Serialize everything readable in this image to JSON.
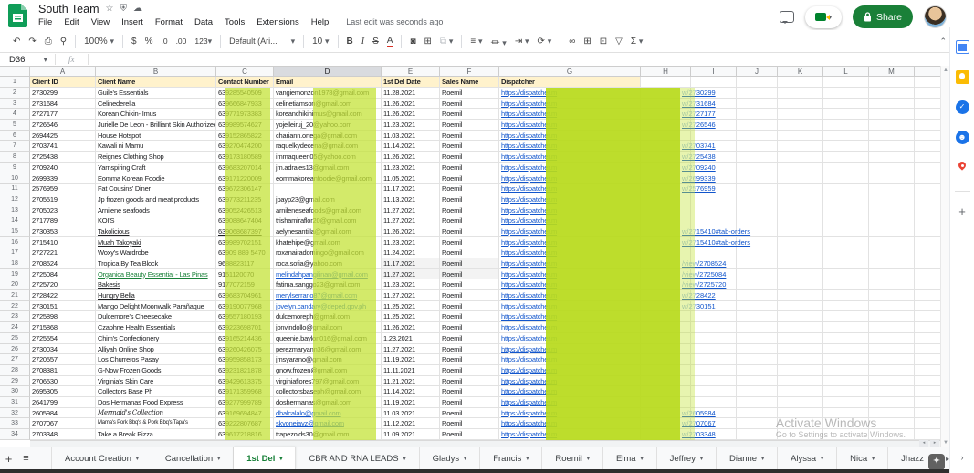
{
  "titlebar": {
    "title": "South Team",
    "menu": [
      "File",
      "Edit",
      "View",
      "Insert",
      "Format",
      "Data",
      "Tools",
      "Extensions",
      "Help"
    ],
    "last_edit": "Last edit was seconds ago",
    "share_label": "Share"
  },
  "toolbar": {
    "zoom": "100%",
    "currency": "$",
    "percent": "%",
    "dec_less": ".0",
    "dec_more": ".00",
    "more_formats": "123",
    "font": "Default (Ari...",
    "font_size": "10",
    "bold": "B",
    "italic": "I",
    "strike": "S",
    "text_color": "A",
    "functions": "Σ"
  },
  "formula_bar": {
    "cell_ref": "D36",
    "fx": "fx"
  },
  "grid": {
    "col_letters": [
      "A",
      "B",
      "C",
      "D",
      "E",
      "F",
      "G",
      "H",
      "I",
      "J",
      "K",
      "L",
      "M",
      ""
    ],
    "selected_col": "D",
    "header_row": [
      "Client ID",
      "Client Name",
      "Contact Number",
      "Email",
      "1st Del Date",
      "Sales Name",
      "Dispatcher"
    ],
    "disp_prefix": "https://dispatcher.m",
    "rows": [
      {
        "n": 2,
        "id": "2730299",
        "name": "Guile's Essentials",
        "phone": "639285540509",
        "email": "vangiemonzon1978@gmail.com",
        "date": "11.28.2021",
        "sales": "Roemil",
        "h_tint": "w/27",
        "h_dark": "30299"
      },
      {
        "n": 3,
        "id": "2731684",
        "name": "Celinederella",
        "phone": "639666847933",
        "email": "celinetiamson@gmail.com",
        "date": "11.26.2021",
        "sales": "Roemil",
        "h_tint": "w/27",
        "h_dark": "31684"
      },
      {
        "n": 4,
        "id": "2727177",
        "name": "Korean Chikin- Imus",
        "phone": "639771973383",
        "email": "koreanchikinimus@gmail.com",
        "date": "11.26.2021",
        "sales": "Roemil",
        "h_tint": "w/27",
        "h_dark": "27177"
      },
      {
        "n": 5,
        "id": "2726546",
        "name": "Jurielle De Leon - Brilliant Skin Authorized Seller",
        "phone": "639989574627",
        "email": "yojelleiruj_20@yahoo.com",
        "date": "11.23.2021",
        "sales": "Roemil",
        "h_tint": "w/27",
        "h_dark": "26546"
      },
      {
        "n": 6,
        "id": "2694425",
        "name": "House Hotspot",
        "phone": "639152865822",
        "email": "chariann.ortega@gmail.com",
        "date": "11.03.2021",
        "sales": "Roemil",
        "h_tint": "",
        "h_dark": ""
      },
      {
        "n": 7,
        "id": "2703741",
        "name": "Kawali ni Mamu",
        "phone": "639270474200",
        "email": "raquelkydecena@gmail.com",
        "date": "11.14.2021",
        "sales": "Roemil",
        "h_tint": "w/27",
        "h_dark": "03741"
      },
      {
        "n": 8,
        "id": "2725438",
        "name": "Reignes Clothing Shop",
        "phone": "639173180589",
        "email": "immaqueen05@yahoo.com",
        "date": "11.26.2021",
        "sales": "Roemil",
        "h_tint": "w/27",
        "h_dark": "25438"
      },
      {
        "n": 9,
        "id": "2709240",
        "name": "Yarnspiring Craft",
        "phone": "639683207014",
        "email": "jm.adrales13@gmail.com",
        "date": "11.23.2021",
        "sales": "Roemil",
        "h_tint": "w/27",
        "h_dark": "09240"
      },
      {
        "n": 10,
        "id": "2699339",
        "name": "Eomma Korean Foodie",
        "phone": "639171220009",
        "email": "eommakoreanfoodie@gmail.com",
        "date": "11.05.2021",
        "sales": "Roemil",
        "h_tint": "w/26",
        "h_dark": "99339"
      },
      {
        "n": 11,
        "id": "2576959",
        "name": "Fat Cousins' Diner",
        "phone": "639672306147",
        "email": "",
        "date": "11.17.2021",
        "sales": "Roemil",
        "h_tint": "w/25",
        "h_dark": "76959"
      },
      {
        "n": 12,
        "id": "2705519",
        "name": "Jp frozen goods and meat products",
        "phone": "639773211235",
        "email": "jpayp23@gmail.com",
        "date": "11.13.2021",
        "sales": "Roemil",
        "h_tint": "",
        "h_dark": ""
      },
      {
        "n": 13,
        "id": "2705023",
        "name": "Arnilene seafoods",
        "phone": "639052426513",
        "email": "arnileneseafoods@gmail.com",
        "date": "11.27.2021",
        "sales": "Roemil",
        "h_tint": "",
        "h_dark": ""
      },
      {
        "n": 14,
        "id": "2717789",
        "name": "KOI'S",
        "phone": "639088647404",
        "email": "trishamiraflor20@gmail.com",
        "date": "11.27.2021",
        "sales": "Roemil",
        "h_tint": "",
        "h_dark": ""
      },
      {
        "n": 15,
        "id": "2730353",
        "name": "Takolicious",
        "name_style": "dlink",
        "phone": "639068687397",
        "phone_style": "dlink",
        "email": "aelynesantilla@gmail.com",
        "date": "11.26.2021",
        "sales": "Roemil",
        "h_tint": "w/27",
        "h_dark": "15410#tab-orders"
      },
      {
        "n": 16,
        "id": "2715410",
        "name": "Muah Takoyaki",
        "name_style": "dlink",
        "phone": "639989702151",
        "email": "khatehipe@gmail.com",
        "date": "11.23.2021",
        "sales": "Roemil",
        "h_tint": "w/27",
        "h_dark": "15410#tab-orders"
      },
      {
        "n": 17,
        "id": "2727221",
        "name": "Woxy's Wardrobe",
        "phone": "63909 889 5470",
        "email": "roxanairadomingo@gmail.com",
        "date": "11.24.2021",
        "sales": "Roemil",
        "h_tint": "",
        "h_dark": ""
      },
      {
        "n": 18,
        "id": "2708524",
        "name": "Tropica By Tea Block",
        "phone": "9688823117",
        "email": "roca.sofia@yahoo.com",
        "date": "11.17.2021",
        "sales": "Roemil",
        "h_tint": "/view",
        "h_dark": "/2708524",
        "shade": true
      },
      {
        "n": 19,
        "id": "2725084",
        "name": "Organica Beauty Essential - Las Pinas",
        "name_style": "glink",
        "phone": "9151120070",
        "email": "melindahpangilinan@gmail.com",
        "email_style": "link",
        "date": "11.27.2021",
        "sales": "Roemil",
        "h_tint": "/view",
        "h_dark": "/2725084",
        "shade": true
      },
      {
        "n": 20,
        "id": "2725720",
        "name": "Bakesis",
        "name_style": "dlink",
        "phone": "9177072159",
        "email": "fatima.sanggo23@gmail.com",
        "date": "11.23.2021",
        "sales": "Roemil",
        "h_tint": "/view",
        "h_dark": "/2725720"
      },
      {
        "n": 21,
        "id": "2728422",
        "name": "Hungry Bella",
        "name_style": "dlink",
        "phone": "639683704961",
        "email": "merylserrano87@gmail.com",
        "email_style": "link",
        "date": "11.27.2021",
        "sales": "Roemil",
        "h_tint": "w/27",
        "h_dark": "28422"
      },
      {
        "n": 22,
        "id": "2730151",
        "name": "Mango Delight Moonwalk Parañaque",
        "name_style": "dlink",
        "phone": "639190077968",
        "email": "jovelyn.candary@deped.gov.ph",
        "email_style": "link",
        "date": "11.25.2021",
        "sales": "Roemil",
        "h_tint": "w/27",
        "h_dark": "30151"
      },
      {
        "n": 23,
        "id": "2725898",
        "name": "Dulcemore's Cheesecake",
        "phone": "639557180193",
        "email": "dulcemoreph@gmail.com",
        "date": "11.25.2021",
        "sales": "Roemil",
        "h_tint": "",
        "h_dark": ""
      },
      {
        "n": 24,
        "id": "2715868",
        "name": "Czaphne Health Essentials",
        "phone": "639223698701",
        "email": "jonvindollo@gmail.com",
        "date": "11.26.2021",
        "sales": "Roemil",
        "h_tint": "",
        "h_dark": ""
      },
      {
        "n": 25,
        "id": "2725554",
        "name": "Chim's Confectionery",
        "phone": "639165214436",
        "email": "queenie.baylon016@gmail.com",
        "date": "1.23.2021",
        "sales": "Roemil",
        "h_tint": "",
        "h_dark": ""
      },
      {
        "n": 26,
        "id": "2730034",
        "name": "Alliyah Online Shop",
        "phone": "639260426075",
        "email": "perezmaryann36@gmail.com",
        "date": "11.27.2021",
        "sales": "Roemil",
        "h_tint": "",
        "h_dark": ""
      },
      {
        "n": 27,
        "id": "2720557",
        "name": "Los Churreros Pasay",
        "phone": "639959858173",
        "email": "jmsyarano@gmail.com",
        "date": "11.19.2021",
        "sales": "Roemil",
        "h_tint": "",
        "h_dark": ""
      },
      {
        "n": 28,
        "id": "2708381",
        "name": "G-Now Frozen Goods",
        "phone": "639231821878",
        "email": "gnow.frozen@gmail.com",
        "date": "11.11.2021",
        "sales": "Roemil",
        "h_tint": "",
        "h_dark": ""
      },
      {
        "n": 29,
        "id": "2706530",
        "name": "Virginia's Skin Care",
        "phone": "639429613375",
        "email": "virginiaflores797@gmail.com",
        "date": "11.21.2021",
        "sales": "Roemil",
        "h_tint": "",
        "h_dark": ""
      },
      {
        "n": 30,
        "id": "2695305",
        "name": "Collectors Base Ph",
        "phone": "639171359968",
        "email": "collectorsbaseph@gmail.com",
        "date": "11.14.2021",
        "sales": "Roemil",
        "h_tint": "",
        "h_dark": ""
      },
      {
        "n": 31,
        "id": "2641799",
        "name": "Dos Hermanas Food Express",
        "phone": "639277999789",
        "email": "doshermanas@gmail.com",
        "date": "11.19.2021",
        "sales": "Roemil",
        "h_tint": "",
        "h_dark": ""
      },
      {
        "n": 32,
        "id": "2605984",
        "name": "Mermaid's Collection",
        "name_style": "script",
        "phone": "639169694847",
        "email": "dhalcalalo@gmail.com",
        "email_style": "link",
        "date": "11.03.2021",
        "sales": "Roemil",
        "h_tint": "w/26",
        "h_dark": "05984"
      },
      {
        "n": 33,
        "id": "2707067",
        "name": "Mama's Pork Bbq's & Pork Bbq's Tapa's",
        "name_style": "tiny",
        "phone": "639222807687",
        "email": "skyonejayz@gmail.com",
        "email_style": "link",
        "date": "11.12.2021",
        "sales": "Roemil",
        "h_tint": "w/27",
        "h_dark": "07067"
      },
      {
        "n": 34,
        "id": "2703348",
        "name": "Take a Break Pizza",
        "phone": "639617218816",
        "email": "trapezoids30@gmail.com",
        "date": "11.09.2021",
        "sales": "Roemil",
        "h_tint": "w/27",
        "h_dark": "03348"
      }
    ]
  },
  "tabs": {
    "items": [
      "Account Creation",
      "Cancellation",
      "1st Del",
      "CBR AND RNA LEADS",
      "Gladys",
      "Francis",
      "Roemil",
      "Elma",
      "Jeffrey",
      "Dianne",
      "Alyssa",
      "Nica",
      "Jhazz"
    ],
    "active": "1st Del"
  },
  "watermark": {
    "line1": "Activate Windows",
    "line2": "Go to Settings to activate Windows."
  },
  "colors": {
    "highlight": "#c4e338",
    "active_tab": "#188038",
    "share": "#1a8038",
    "link": "#1155cc"
  }
}
